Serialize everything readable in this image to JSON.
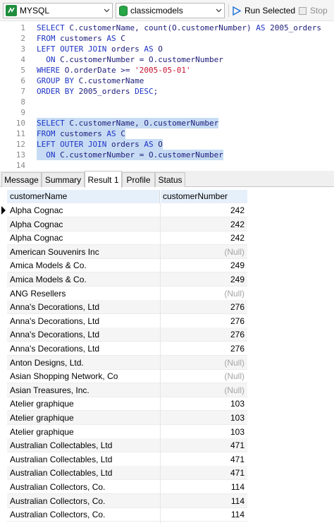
{
  "toolbar": {
    "connection": "MYSQL",
    "database": "classicmodels",
    "run_selected": "Run Selected",
    "stop": "Stop",
    "colors": {
      "play": "#1a6fd6",
      "db": "#27a645",
      "conn": "#1e8e3e"
    }
  },
  "editor": {
    "line_numbers": [
      "1",
      "2",
      "3",
      "4",
      "5",
      "6",
      "7",
      "8",
      "9",
      "10",
      "11",
      "12",
      "13",
      "14"
    ]
  },
  "tabs": [
    "Message",
    "Summary",
    "Result 1",
    "Profile",
    "Status"
  ],
  "grid": {
    "columns": [
      "customerName",
      "customerNumber"
    ],
    "rows": [
      [
        "Alpha Cognac",
        "242"
      ],
      [
        "Alpha Cognac",
        "242"
      ],
      [
        "Alpha Cognac",
        "242"
      ],
      [
        "American Souvenirs Inc",
        "(Null)"
      ],
      [
        "Amica Models & Co.",
        "249"
      ],
      [
        "Amica Models & Co.",
        "249"
      ],
      [
        "ANG Resellers",
        "(Null)"
      ],
      [
        "Anna's Decorations, Ltd",
        "276"
      ],
      [
        "Anna's Decorations, Ltd",
        "276"
      ],
      [
        "Anna's Decorations, Ltd",
        "276"
      ],
      [
        "Anna's Decorations, Ltd",
        "276"
      ],
      [
        "Anton Designs, Ltd.",
        "(Null)"
      ],
      [
        "Asian Shopping Network, Co",
        "(Null)"
      ],
      [
        "Asian Treasures, Inc.",
        "(Null)"
      ],
      [
        "Atelier graphique",
        "103"
      ],
      [
        "Atelier graphique",
        "103"
      ],
      [
        "Atelier graphique",
        "103"
      ],
      [
        "Australian Collectables, Ltd",
        "471"
      ],
      [
        "Australian Collectables, Ltd",
        "471"
      ],
      [
        "Australian Collectables, Ltd",
        "471"
      ],
      [
        "Australian Collectors, Co.",
        "114"
      ],
      [
        "Australian Collectors, Co.",
        "114"
      ],
      [
        "Australian Collectors, Co.",
        "114"
      ]
    ]
  }
}
